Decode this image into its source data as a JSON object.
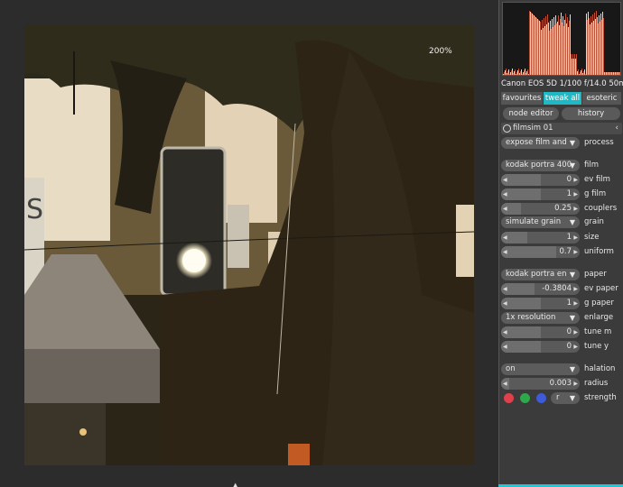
{
  "viewer": {
    "zoom": "200%",
    "histogram_colors": [
      "#ffffff",
      "#e7d24a",
      "#3ab0d8",
      "#d95a3a",
      "#8a5cc8",
      "#6acb5a"
    ]
  },
  "panel": {
    "exif": "Canon EOS 5D 1/100 f/14.0 50m",
    "tabs": [
      {
        "label": "favourites",
        "active": false
      },
      {
        "label": "tweak all",
        "active": true
      },
      {
        "label": "esoteric",
        "active": false
      }
    ],
    "node_editor": "node editor",
    "history": "history",
    "module_name": "filmsim 01",
    "collapse_icon": "chevron-left-icon"
  },
  "params": {
    "process": {
      "value": "expose film and",
      "label": "process"
    },
    "film": {
      "value": "kodak portra 400",
      "label": "film"
    },
    "ev_film": {
      "value": "0",
      "label": "ev film",
      "fill": 0.5
    },
    "g_film": {
      "value": "1",
      "label": "g film",
      "fill": 0.5
    },
    "couplers": {
      "value": "0.25",
      "label": "couplers",
      "fill": 0.25
    },
    "grain": {
      "value": "simulate grain",
      "label": "grain"
    },
    "size": {
      "value": "1",
      "label": "size",
      "fill": 0.33
    },
    "uniform": {
      "value": "0.7",
      "label": "uniform",
      "fill": 0.7
    },
    "paper": {
      "value": "kodak portra en",
      "label": "paper"
    },
    "ev_paper": {
      "value": "-0.3804",
      "label": "ev paper",
      "fill": 0.42
    },
    "g_paper": {
      "value": "1",
      "label": "g paper",
      "fill": 0.5
    },
    "enlarge": {
      "value": "1x resolution",
      "label": "enlarge"
    },
    "tune_m": {
      "value": "0",
      "label": "tune m",
      "fill": 0.5
    },
    "tune_y": {
      "value": "0",
      "label": "tune y",
      "fill": 0.5
    },
    "halation": {
      "value": "on",
      "label": "halation"
    },
    "radius": {
      "value": "0.003",
      "label": "radius",
      "fill": 0.1
    },
    "strength": {
      "channel": "r",
      "label": "strength",
      "dot_colors": [
        "#e0404a",
        "#2ea84a",
        "#3d5ad8"
      ]
    }
  }
}
